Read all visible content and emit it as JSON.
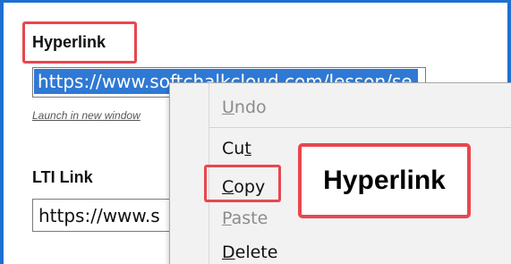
{
  "hyperlink_field": {
    "label": "Hyperlink",
    "value": "https://www.softchalkcloud.com/lesson/se",
    "launch_text": "Launch in new window"
  },
  "lti_field": {
    "label": "LTI Link",
    "value": "https://www.s"
  },
  "context_menu": {
    "undo": {
      "pre": "",
      "key": "U",
      "post": "ndo"
    },
    "cut": {
      "pre": "Cu",
      "key": "t",
      "post": ""
    },
    "copy": {
      "pre": "",
      "key": "C",
      "post": "opy"
    },
    "paste": {
      "pre": "",
      "key": "P",
      "post": "aste"
    },
    "delete": {
      "pre": "",
      "key": "D",
      "post": "elete"
    }
  },
  "callout": {
    "text": "Hyperlink"
  },
  "colors": {
    "frame": "#1f6fd1",
    "callout_border": "#e8474f",
    "selection": "#2f79d4"
  }
}
